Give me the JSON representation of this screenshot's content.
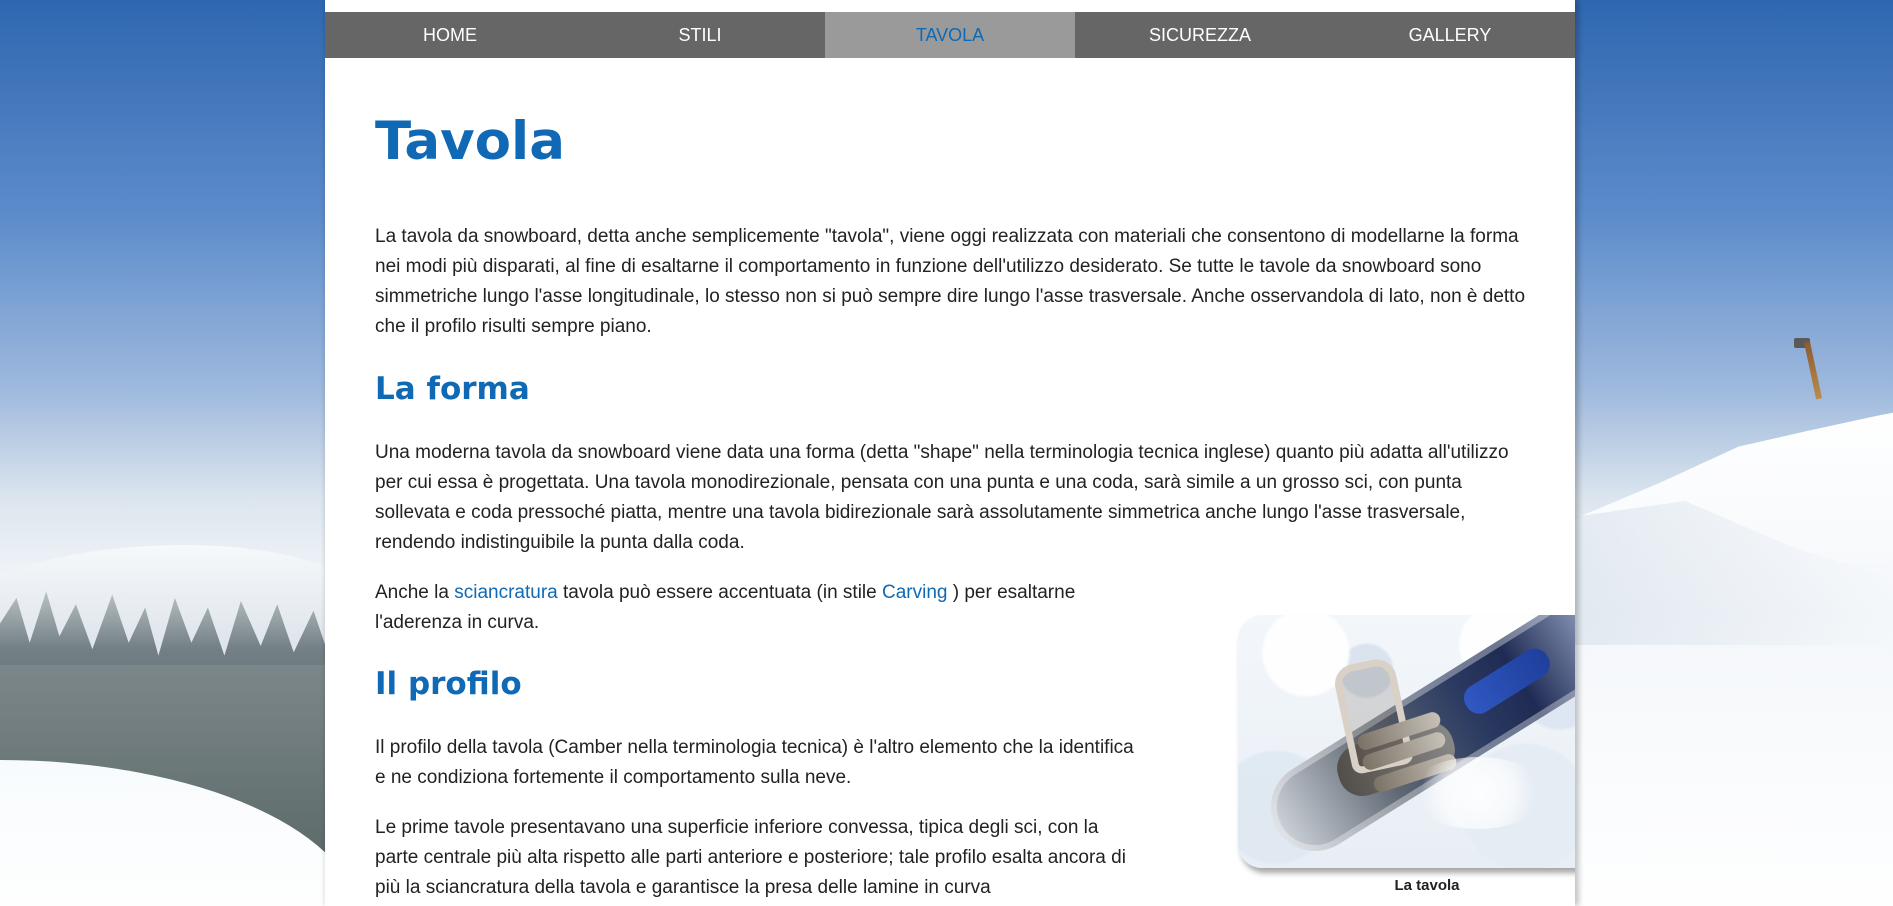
{
  "navigation": {
    "items": [
      {
        "label": "HOME",
        "active": false
      },
      {
        "label": "STILI",
        "active": false
      },
      {
        "label": "TAVOLA",
        "active": true
      },
      {
        "label": "SICUREZZA",
        "active": false
      },
      {
        "label": "GALLERY",
        "active": false
      }
    ]
  },
  "page": {
    "title": "Tavola",
    "intro": "La tavola da snowboard, detta anche semplicemente \"tavola\", viene oggi realizzata con materiali che consentono di modellarne la forma nei modi più disparati, al fine di esaltarne il comportamento in funzione dell'utilizzo desiderato. Se tutte le tavole da snowboard sono simmetriche lungo l'asse longitudinale, lo stesso non si può sempre dire lungo l'asse trasversale. Anche osservandola di lato, non è detto che il profilo risulti sempre piano."
  },
  "sections": {
    "forma": {
      "heading": "La forma",
      "paragraph_1": "Una moderna tavola da snowboard viene data una forma (detta \"shape\" nella terminologia tecnica inglese) quanto più adatta all'utilizzo per cui essa è progettata. Una tavola monodirezionale, pensata con una punta e una coda, sarà simile a un grosso sci, con punta sollevata e coda pressoché piatta, mentre una tavola bidirezionale sarà assolutamente simmetrica anche lungo l'asse trasversale, rendendo indistinguibile la punta dalla coda.",
      "paragraph_2": {
        "prefix": "Anche la",
        "link_1": "sciancratura",
        "middle": "tavola può essere accentuata (in stile",
        "link_2": "Carving",
        "suffix": ") per esaltarne l'aderenza in curva."
      }
    },
    "profilo": {
      "heading": "Il profilo",
      "paragraph_1": "Il profilo della tavola (Camber nella terminologia tecnica) è l'altro elemento che la identifica e ne condiziona fortemente il comportamento sulla neve.",
      "paragraph_2": "Le prime tavole presentavano una superficie inferiore convessa, tipica degli sci, con la parte centrale più alta rispetto alle parti anteriore e posteriore; tale profilo esalta ancora di più la sciancratura della tavola e garantisce la presa delle lamine in curva"
    }
  },
  "figure": {
    "caption": "La tavola",
    "image_subject": "snowboard-image"
  },
  "colors": {
    "accent": "#0f69b4",
    "nav_bg": "#666666",
    "nav_active_bg": "#9a9a9a",
    "text": "#222222",
    "page_bg": "#ffffff"
  }
}
